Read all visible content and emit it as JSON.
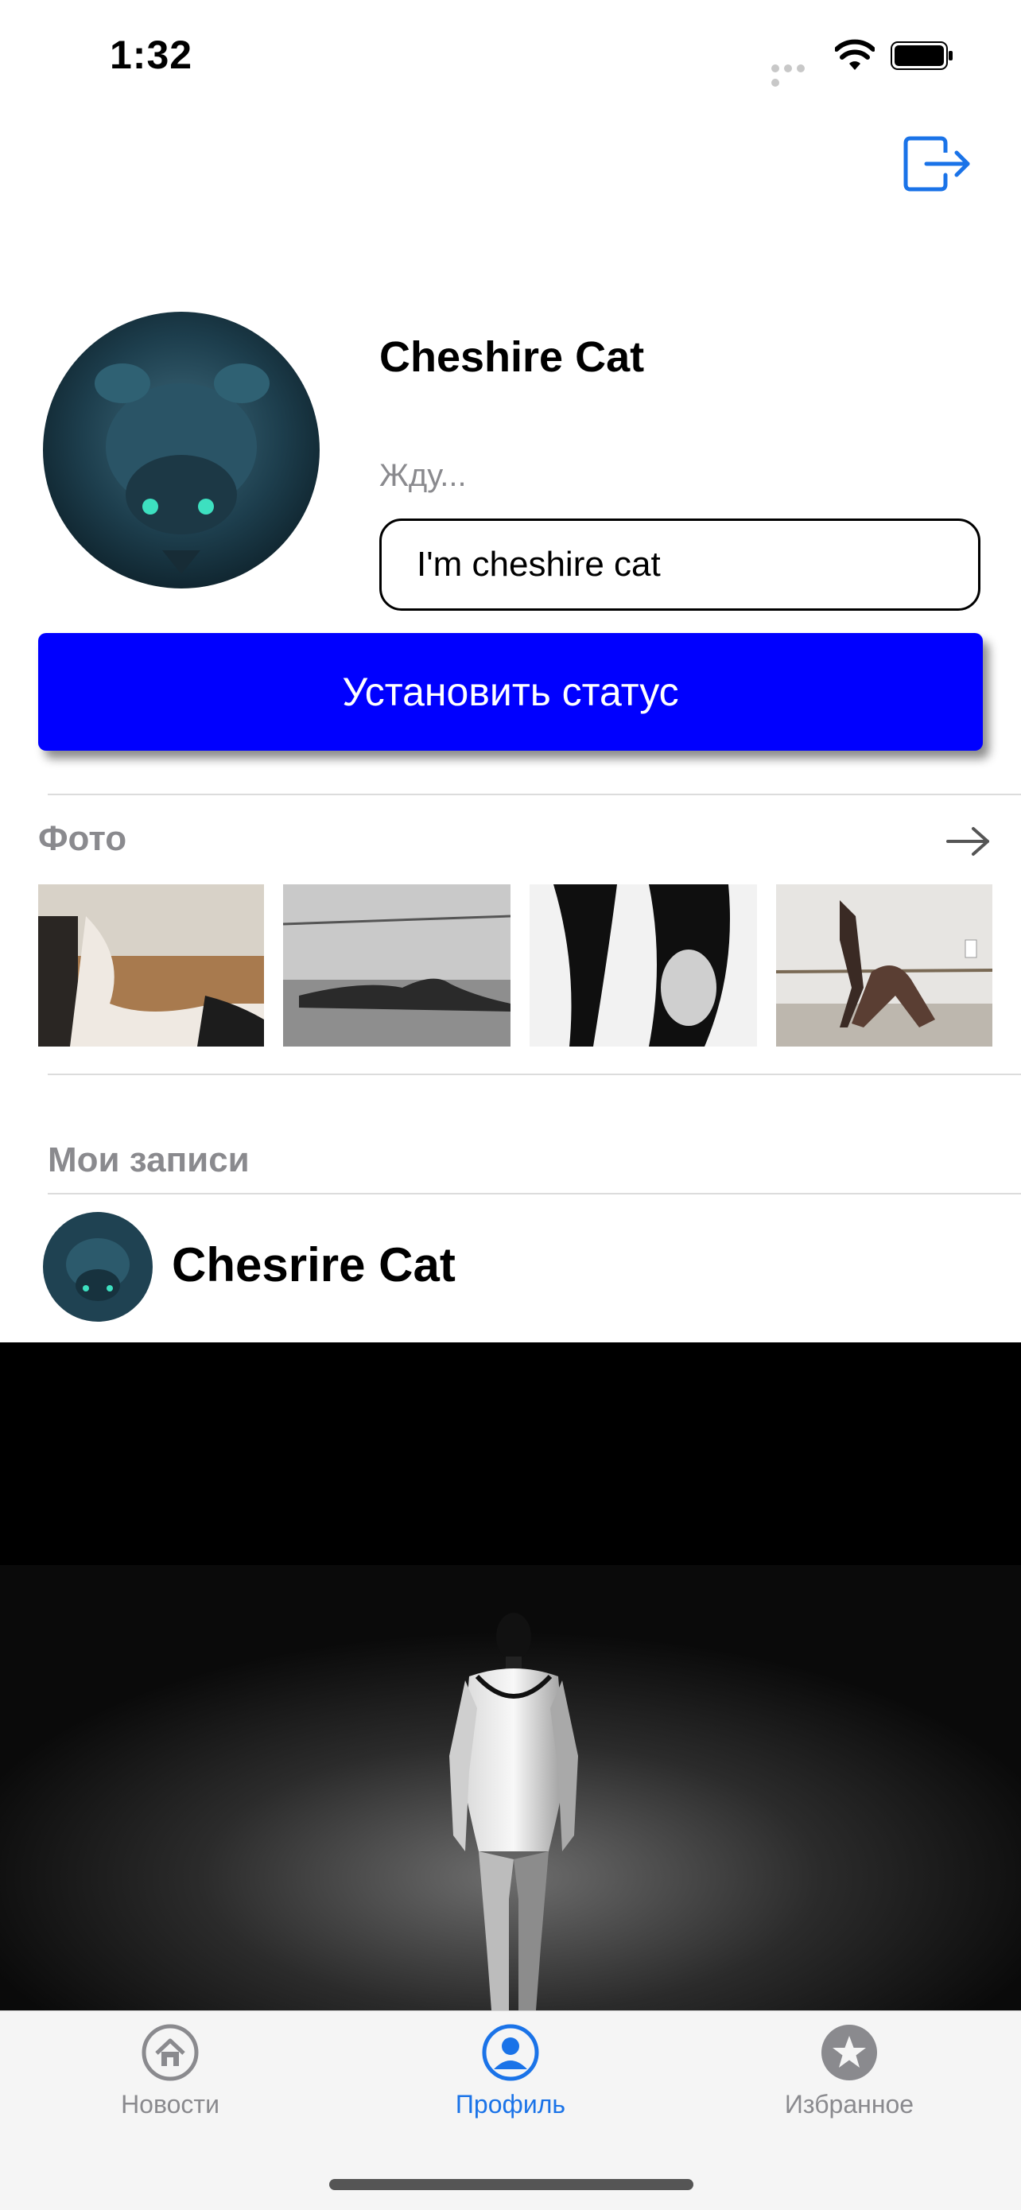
{
  "status_bar": {
    "time": "1:32"
  },
  "header": {
    "logout_icon": "logout-icon"
  },
  "profile": {
    "name": "Cheshire Cat",
    "status": "Жду...",
    "status_input_value": "I'm cheshire cat",
    "set_status_button": "Установить статус"
  },
  "photos": {
    "title": "Фото",
    "arrow_icon": "arrow-right-icon",
    "items": [
      "photo-1",
      "photo-2",
      "photo-3",
      "photo-4"
    ]
  },
  "posts": {
    "title": "Мои записи",
    "items": [
      {
        "author": "Chesrire Cat"
      }
    ]
  },
  "tabbar": {
    "items": [
      {
        "label": "Новости",
        "icon": "home-icon",
        "active": false
      },
      {
        "label": "Профиль",
        "icon": "profile-icon",
        "active": true
      },
      {
        "label": "Избранное",
        "icon": "star-icon",
        "active": false
      }
    ]
  },
  "colors": {
    "accent": "#0000ff",
    "tab_active": "#1a73e8",
    "muted": "#8a8a8e"
  }
}
